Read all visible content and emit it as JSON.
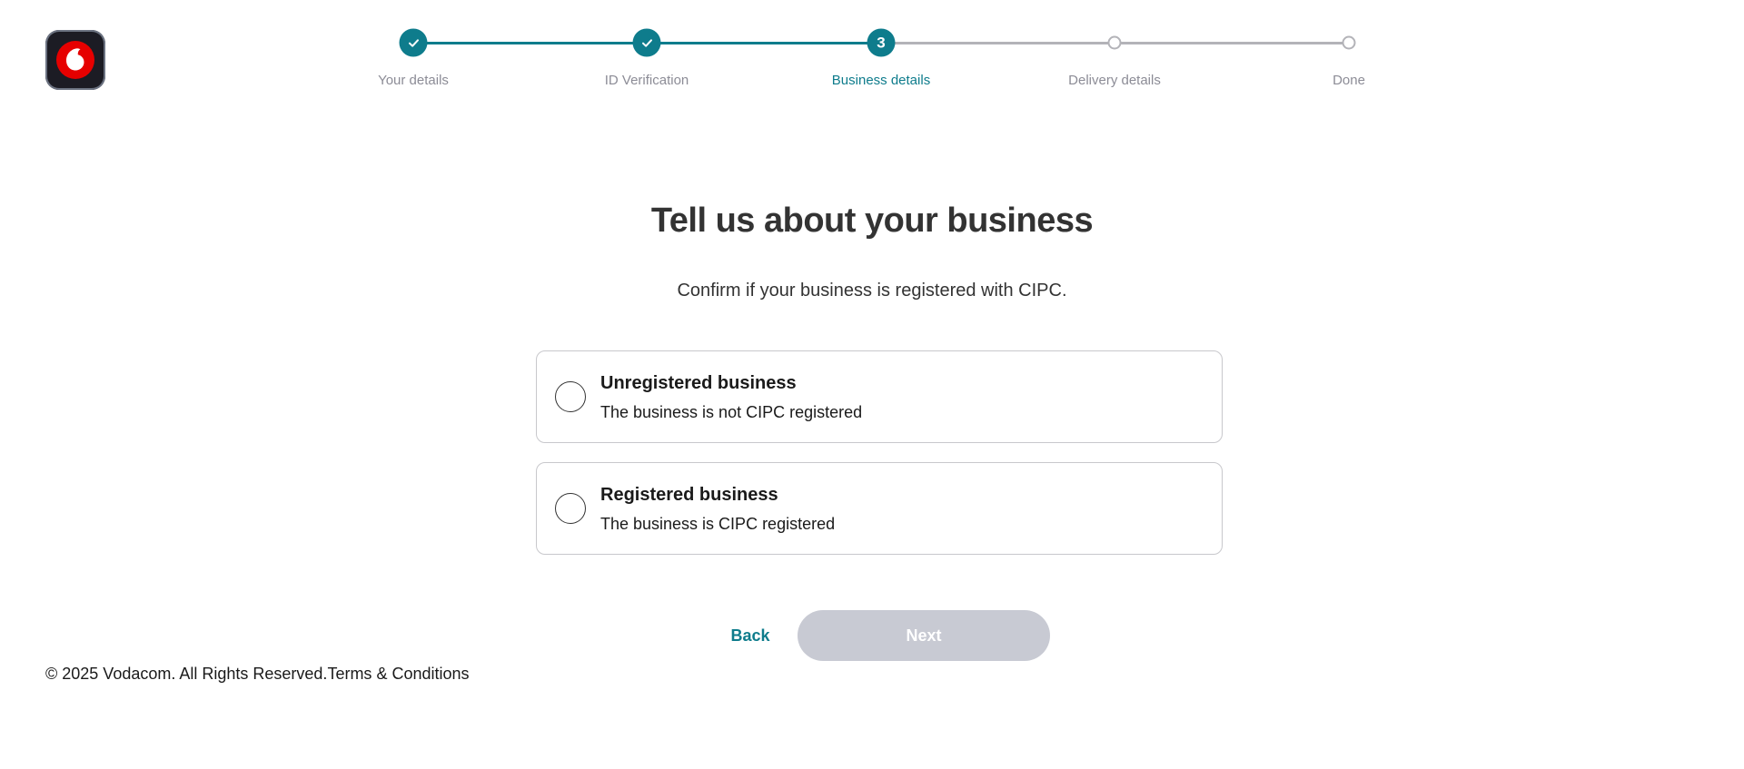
{
  "brand": {
    "logo_icon": "vodafone-speechmark-icon",
    "accent_color": "#0e7c8c",
    "logo_red": "#e60000"
  },
  "stepper": {
    "steps": [
      {
        "label": "Your details",
        "state": "done",
        "marker": ""
      },
      {
        "label": "ID Verification",
        "state": "done",
        "marker": ""
      },
      {
        "label": "Business details",
        "state": "current",
        "marker": "3"
      },
      {
        "label": "Delivery details",
        "state": "todo",
        "marker": ""
      },
      {
        "label": "Done",
        "state": "todo",
        "marker": ""
      }
    ]
  },
  "main": {
    "title": "Tell us about your business",
    "subtitle": "Confirm if your business is registered with CIPC.",
    "options": [
      {
        "title": "Unregistered business",
        "description": "The business is not CIPC registered",
        "selected": false
      },
      {
        "title": "Registered business",
        "description": "The business is CIPC registered",
        "selected": false
      }
    ]
  },
  "actions": {
    "back_label": "Back",
    "next_label": "Next",
    "next_enabled": false
  },
  "footer": {
    "copyright": "© 2025 Vodacom. All Rights Reserved.",
    "terms_label": "Terms & Conditions"
  }
}
